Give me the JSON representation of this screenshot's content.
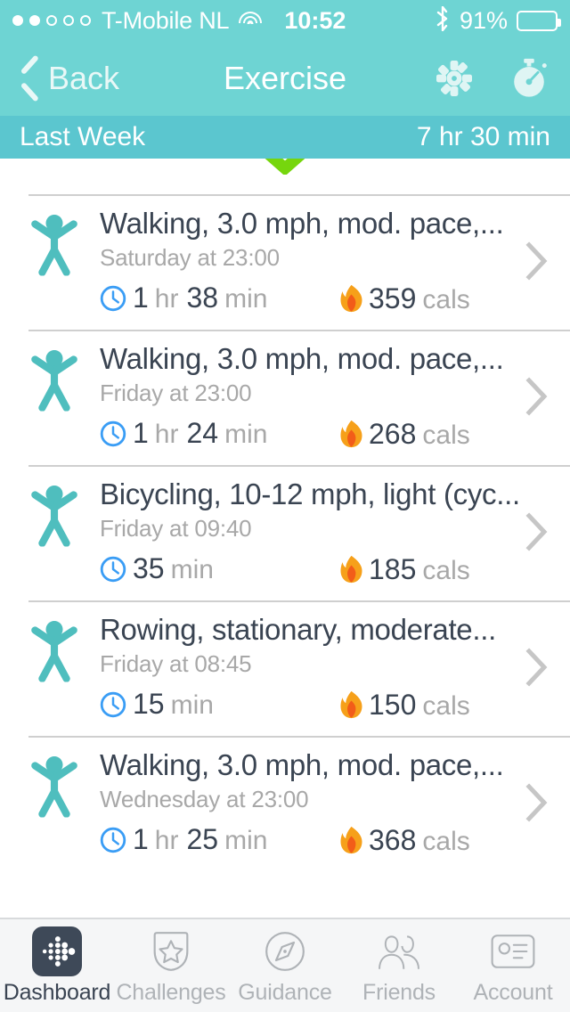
{
  "status_bar": {
    "signal_dots_filled": 2,
    "signal_dots_total": 5,
    "carrier": "T-Mobile NL",
    "wifi_icon": "wifi-icon",
    "time": "10:52",
    "bluetooth_icon": "bluetooth-icon",
    "battery_percent": "91%",
    "battery_icon": "battery-icon"
  },
  "nav": {
    "back_label": "Back",
    "title": "Exercise",
    "settings_icon": "gear-icon",
    "stopwatch_icon": "stopwatch-icon"
  },
  "week_bar": {
    "label": "Last Week",
    "total": "7 hr 30 min"
  },
  "refresh": {
    "chevron_icon": "chevron-down-icon",
    "color": "#76D60D"
  },
  "colors": {
    "nav_teal": "#6ED4D3",
    "week_teal": "#5BC6CF",
    "person_teal": "#4FBEBE",
    "clock_blue": "#3A9DF5",
    "flame_orange": "#F79B16",
    "text_dark": "#3A4452",
    "text_gray": "#A8A8A8",
    "tabbar_bg": "#F5F6F7",
    "fitbit_navy": "#3E4958"
  },
  "exercises": [
    {
      "icon": "person-icon",
      "title": "Walking, 3.0 mph, mod. pace,...",
      "when": "Saturday at 23:00",
      "duration_hours": "1",
      "hours_unit": "hr",
      "duration_minutes": "38",
      "minutes_unit": "min",
      "calories": "359",
      "calories_unit": "cals",
      "chevron": "chevron-right-icon"
    },
    {
      "icon": "person-icon",
      "title": "Walking, 3.0 mph, mod. pace,...",
      "when": "Friday at 23:00",
      "duration_hours": "1",
      "hours_unit": "hr",
      "duration_minutes": "24",
      "minutes_unit": "min",
      "calories": "268",
      "calories_unit": "cals",
      "chevron": "chevron-right-icon"
    },
    {
      "icon": "person-icon",
      "title": "Bicycling, 10-12 mph, light (cyc...",
      "when": "Friday at 09:40",
      "duration_hours": "",
      "hours_unit": "",
      "duration_minutes": "35",
      "minutes_unit": "min",
      "calories": "185",
      "calories_unit": "cals",
      "chevron": "chevron-right-icon"
    },
    {
      "icon": "person-icon",
      "title": "Rowing, stationary, moderate...",
      "when": "Friday at 08:45",
      "duration_hours": "",
      "hours_unit": "",
      "duration_minutes": "15",
      "minutes_unit": "min",
      "calories": "150",
      "calories_unit": "cals",
      "chevron": "chevron-right-icon"
    },
    {
      "icon": "person-icon",
      "title": "Walking, 3.0 mph, mod. pace,...",
      "when": "Wednesday at 23:00",
      "duration_hours": "1",
      "hours_unit": "hr",
      "duration_minutes": "25",
      "minutes_unit": "min",
      "calories": "368",
      "calories_unit": "cals",
      "chevron": "chevron-right-icon"
    }
  ],
  "tabs": [
    {
      "label": "Dashboard",
      "icon": "fitbit-logo-icon",
      "active": true
    },
    {
      "label": "Challenges",
      "icon": "shield-star-icon",
      "active": false
    },
    {
      "label": "Guidance",
      "icon": "compass-icon",
      "active": false
    },
    {
      "label": "Friends",
      "icon": "friends-icon",
      "active": false
    },
    {
      "label": "Account",
      "icon": "id-card-icon",
      "active": false
    }
  ]
}
